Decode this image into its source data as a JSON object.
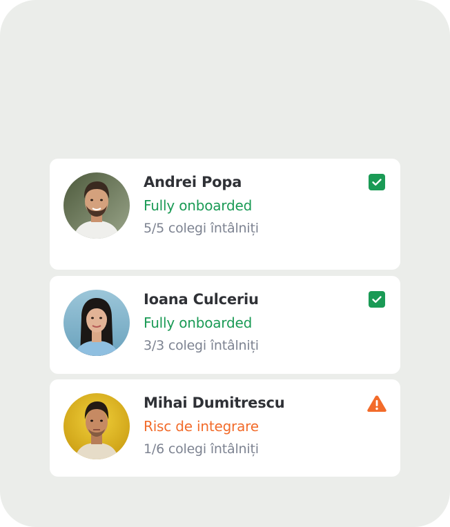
{
  "people": [
    {
      "name": "Andrei Popa",
      "status": "Fully onboarded",
      "status_kind": "ok",
      "met": "5/5 colegi întâlniți",
      "badge_icon": "check-square-icon",
      "avatar_bg": "#6a7a58"
    },
    {
      "name": "Ioana Culceriu",
      "status": "Fully onboarded",
      "status_kind": "ok",
      "met": "3/3 colegi întâlniți",
      "badge_icon": "check-square-icon",
      "avatar_bg": "#7fb0c7"
    },
    {
      "name": "Mihai Dumitrescu",
      "status": "Risc de integrare",
      "status_kind": "risk",
      "met": "1/6 colegi întâlniți",
      "badge_icon": "warning-triangle-icon",
      "avatar_bg": "#d9b21c"
    }
  ],
  "colors": {
    "panel": "#ebedea",
    "ok": "#1a9a55",
    "risk": "#f26b2a",
    "name": "#2f3136",
    "muted": "#7d8391"
  }
}
